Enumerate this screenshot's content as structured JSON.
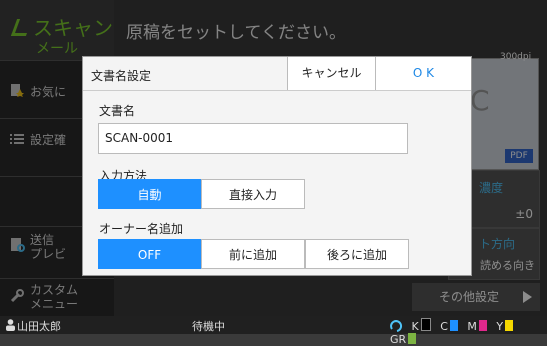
{
  "mode": {
    "title": "スキャン",
    "subtitle": "メール"
  },
  "header": {
    "message": "原稿をセットしてください。"
  },
  "sidebar": {
    "items": [
      {
        "label": "お気に"
      },
      {
        "label": "設定確"
      },
      {
        "label": "送信\nプレビ"
      },
      {
        "label": "カスタム\nメニュー"
      }
    ]
  },
  "preview": {
    "dpi": "300dpi",
    "badge": "PDF",
    "letter": "C"
  },
  "right_panel": {
    "density": {
      "label": "濃度",
      "value": "±0"
    },
    "direction": {
      "label": "ト方向",
      "value": "読める向き"
    },
    "other_settings": "その他設定"
  },
  "dialog": {
    "title": "文書名設定",
    "cancel_label": "キャンセル",
    "ok_label": "O K",
    "docname": {
      "label": "文書名",
      "value": "SCAN-0001"
    },
    "input_method": {
      "label": "入力方法",
      "options": [
        "自動",
        "直接入力"
      ],
      "selected": "自動"
    },
    "owner_name": {
      "label": "オーナー名追加",
      "options": [
        "OFF",
        "前に追加",
        "後ろに追加"
      ],
      "selected": "OFF"
    }
  },
  "statusbar": {
    "user": "山田太郎",
    "status": "待機中",
    "inks": [
      {
        "label": "K",
        "color": "#000000"
      },
      {
        "label": "C",
        "color": "#1e90ff"
      },
      {
        "label": "M",
        "color": "#e0288c"
      },
      {
        "label": "Y",
        "color": "#f5d800"
      },
      {
        "label": "GR",
        "color": "#7cb342"
      }
    ]
  },
  "colors": {
    "accent": "#1e90ff",
    "mode_green": "#7ccc2e"
  }
}
